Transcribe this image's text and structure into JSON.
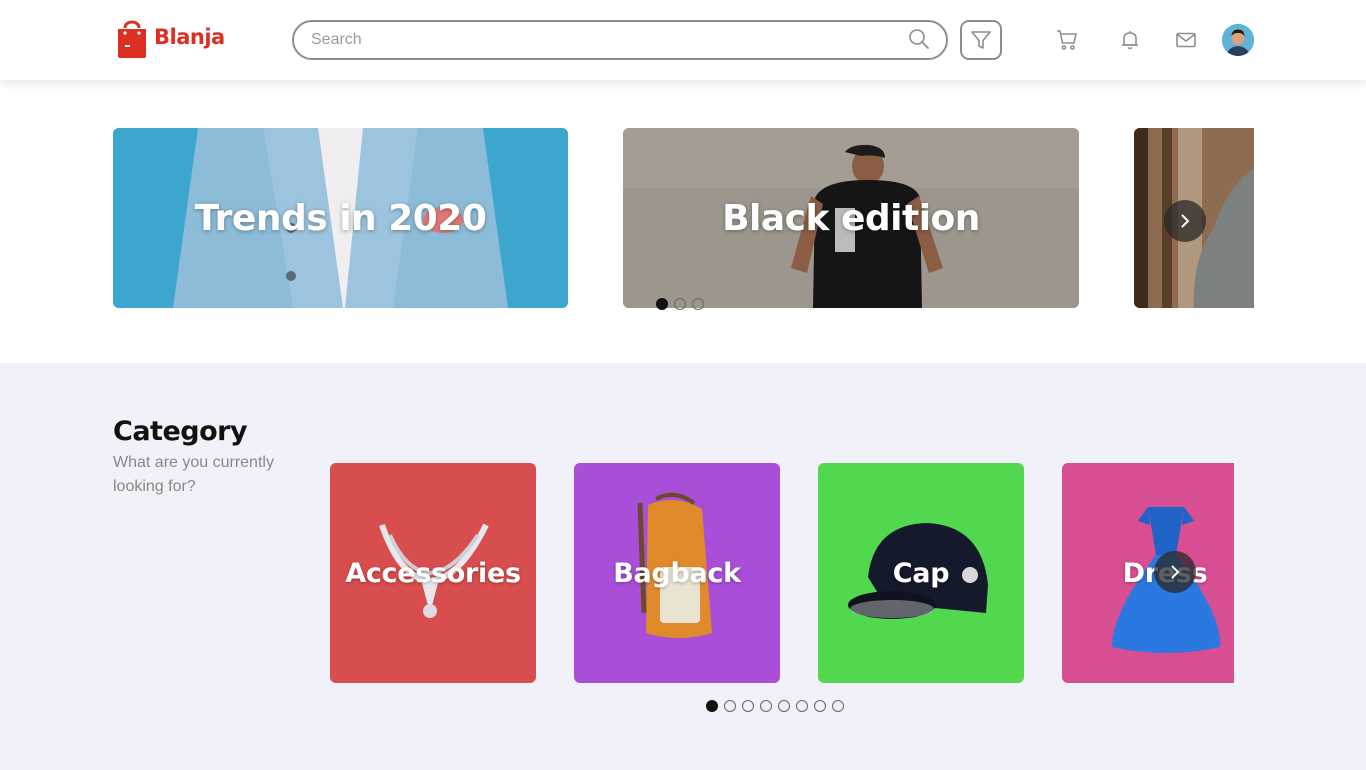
{
  "header": {
    "brand": "Blanja",
    "search_placeholder": "Search",
    "colors": {
      "brand": "#db3022"
    },
    "icons": [
      "shopping-bag-icon",
      "search-icon",
      "filter-icon",
      "cart-icon",
      "bell-icon",
      "mail-icon"
    ]
  },
  "hero": {
    "banners": [
      {
        "title": "Trends in 2020"
      },
      {
        "title": "Black edition"
      },
      {
        "title": ""
      }
    ],
    "active_dot": 0
  },
  "category": {
    "title": "Category",
    "subtitle": "What are you currently looking for?",
    "items": [
      {
        "label": "Accessories",
        "color": "#d84d4d"
      },
      {
        "label": "Bagback",
        "color": "#a94ed9"
      },
      {
        "label": "Cap",
        "color": "#52d84f"
      },
      {
        "label": "Dress",
        "color": "#d84e93"
      }
    ],
    "active_dot": 0
  }
}
